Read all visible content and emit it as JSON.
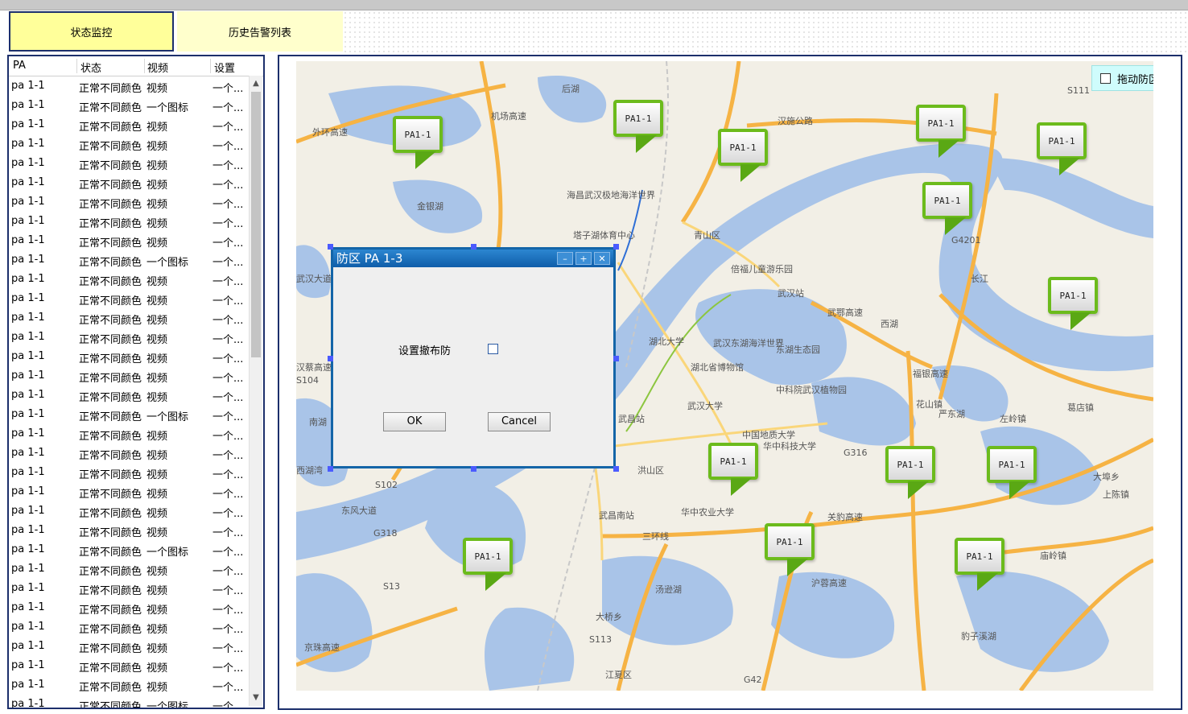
{
  "tabs": [
    {
      "label": "状态监控",
      "active": true
    },
    {
      "label": "历史告警列表",
      "active": false
    }
  ],
  "list": {
    "headers": [
      "PA",
      "状态",
      "视频",
      "设置"
    ],
    "rows": [
      [
        "pa 1-1",
        "正常不同颜色",
        "视频",
        "一个..."
      ],
      [
        "pa 1-1",
        "正常不同颜色",
        "一个图标",
        "一个..."
      ],
      [
        "pa 1-1",
        "正常不同颜色",
        "视频",
        "一个..."
      ],
      [
        "pa 1-1",
        "正常不同颜色",
        "视频",
        "一个..."
      ],
      [
        "pa 1-1",
        "正常不同颜色",
        "视频",
        "一个..."
      ],
      [
        "pa 1-1",
        "正常不同颜色",
        "视频",
        "一个..."
      ],
      [
        "pa 1-1",
        "正常不同颜色",
        "视频",
        "一个..."
      ],
      [
        "pa 1-1",
        "正常不同颜色",
        "视频",
        "一个..."
      ],
      [
        "pa 1-1",
        "正常不同颜色",
        "视频",
        "一个..."
      ],
      [
        "pa 1-1",
        "正常不同颜色",
        "一个图标",
        "一个..."
      ],
      [
        "pa 1-1",
        "正常不同颜色",
        "视频",
        "一个..."
      ],
      [
        "pa 1-1",
        "正常不同颜色",
        "视频",
        "一个..."
      ],
      [
        "pa 1-1",
        "正常不同颜色",
        "视频",
        "一个..."
      ],
      [
        "pa 1-1",
        "正常不同颜色",
        "视频",
        "一个..."
      ],
      [
        "pa 1-1",
        "正常不同颜色",
        "视频",
        "一个..."
      ],
      [
        "pa 1-1",
        "正常不同颜色",
        "视频",
        "一个..."
      ],
      [
        "pa 1-1",
        "正常不同颜色",
        "视频",
        "一个..."
      ],
      [
        "pa 1-1",
        "正常不同颜色",
        "一个图标",
        "一个..."
      ],
      [
        "pa 1-1",
        "正常不同颜色",
        "视频",
        "一个..."
      ],
      [
        "pa 1-1",
        "正常不同颜色",
        "视频",
        "一个..."
      ],
      [
        "pa 1-1",
        "正常不同颜色",
        "视频",
        "一个..."
      ],
      [
        "pa 1-1",
        "正常不同颜色",
        "视频",
        "一个..."
      ],
      [
        "pa 1-1",
        "正常不同颜色",
        "视频",
        "一个..."
      ],
      [
        "pa 1-1",
        "正常不同颜色",
        "视频",
        "一个..."
      ],
      [
        "pa 1-1",
        "正常不同颜色",
        "一个图标",
        "一个..."
      ],
      [
        "pa 1-1",
        "正常不同颜色",
        "视频",
        "一个..."
      ],
      [
        "pa 1-1",
        "正常不同颜色",
        "视频",
        "一个..."
      ],
      [
        "pa 1-1",
        "正常不同颜色",
        "视频",
        "一个..."
      ],
      [
        "pa 1-1",
        "正常不同颜色",
        "视频",
        "一个..."
      ],
      [
        "pa 1-1",
        "正常不同颜色",
        "视频",
        "一个..."
      ],
      [
        "pa 1-1",
        "正常不同颜色",
        "视频",
        "一个..."
      ],
      [
        "pa 1-1",
        "正常不同颜色",
        "视频",
        "一个..."
      ],
      [
        "pa 1-1",
        "正常不同颜色",
        "一个图标",
        "一个..."
      ]
    ]
  },
  "map": {
    "drag_toggle_label": "拖动防区开关",
    "markers": [
      {
        "label": "PA1-1"
      },
      {
        "label": "PA1-1"
      },
      {
        "label": "PA1-1"
      },
      {
        "label": "PA1-1"
      },
      {
        "label": "PA1-1"
      },
      {
        "label": "PA1-1"
      },
      {
        "label": "PA1-1"
      },
      {
        "label": "PA1-1"
      },
      {
        "label": "PA1-1"
      },
      {
        "label": "PA1-1"
      },
      {
        "label": "PA1-1"
      },
      {
        "label": "PA1-1"
      },
      {
        "label": "PA1-1"
      }
    ],
    "place_labels": [
      "后湖",
      "金银湖",
      "海昌武汉极地海洋世界",
      "塔子湖体育中心",
      "汉施公路",
      "青山区",
      "倍福儿童游乐园",
      "武汉站",
      "湖北大学",
      "武汉东湖海洋世界",
      "东湖生态园",
      "湖北省博物馆",
      "中科院武汉植物园",
      "武汉大学",
      "中国地质大学",
      "华中科技大学",
      "洪山区",
      "武昌站",
      "武昌南站",
      "华中农业大学",
      "汤逊湖",
      "大桥乡",
      "江夏区",
      "花山镇",
      "严东湖",
      "左岭镇",
      "葛店镇",
      "大埠乡",
      "上陈镇",
      "庙岭镇",
      "豹子溪湖",
      "西湖",
      "长江",
      "南湖",
      "西湖湾",
      "外环高速",
      "机场高速",
      "武鄂高速",
      "关豹高速",
      "福银高速",
      "沪蓉高速",
      "东风大道",
      "京珠高速",
      "三环线",
      "武汉大道",
      "汉蔡高速",
      "S111",
      "S104",
      "S102",
      "S13",
      "G318",
      "G316",
      "G4201",
      "G42",
      "S113"
    ]
  },
  "dialog": {
    "title": "防区 PA 1-3",
    "minimize": "–",
    "maximize": "+",
    "close": "✕",
    "field_label": "设置撤布防",
    "ok_label": "OK",
    "cancel_label": "Cancel"
  }
}
